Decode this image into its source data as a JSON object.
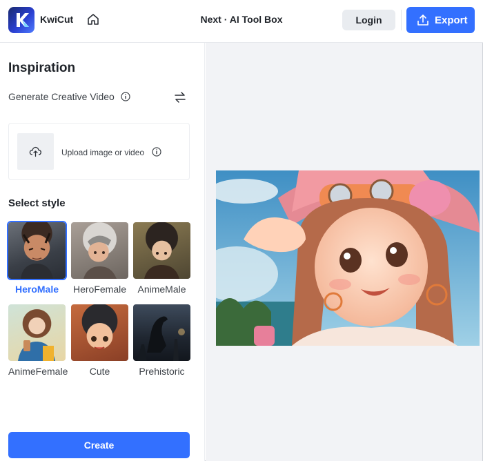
{
  "header": {
    "brand": "KwiCut",
    "center_title": "Next · AI Tool Box",
    "login_label": "Login",
    "export_label": "Export"
  },
  "sidebar": {
    "title": "Inspiration",
    "subtitle": "Generate Creative Video",
    "upload_text": "Upload image or video",
    "style_title": "Select style",
    "styles": [
      {
        "label": "HeroMale",
        "selected": true
      },
      {
        "label": "HeroFemale",
        "selected": false
      },
      {
        "label": "AnimeMale",
        "selected": false
      },
      {
        "label": "AnimeFemale",
        "selected": false
      },
      {
        "label": "Cute",
        "selected": false
      },
      {
        "label": "Prehistoric",
        "selected": false
      }
    ],
    "create_label": "Create"
  },
  "colors": {
    "accent": "#3370ff",
    "panel_bg": "#f2f3f6",
    "button_gray": "#e9ecf0"
  },
  "icons": {
    "home": "home-icon",
    "upload": "upload-icon",
    "info": "info-icon",
    "swap": "swap-icon",
    "export": "export-icon"
  }
}
